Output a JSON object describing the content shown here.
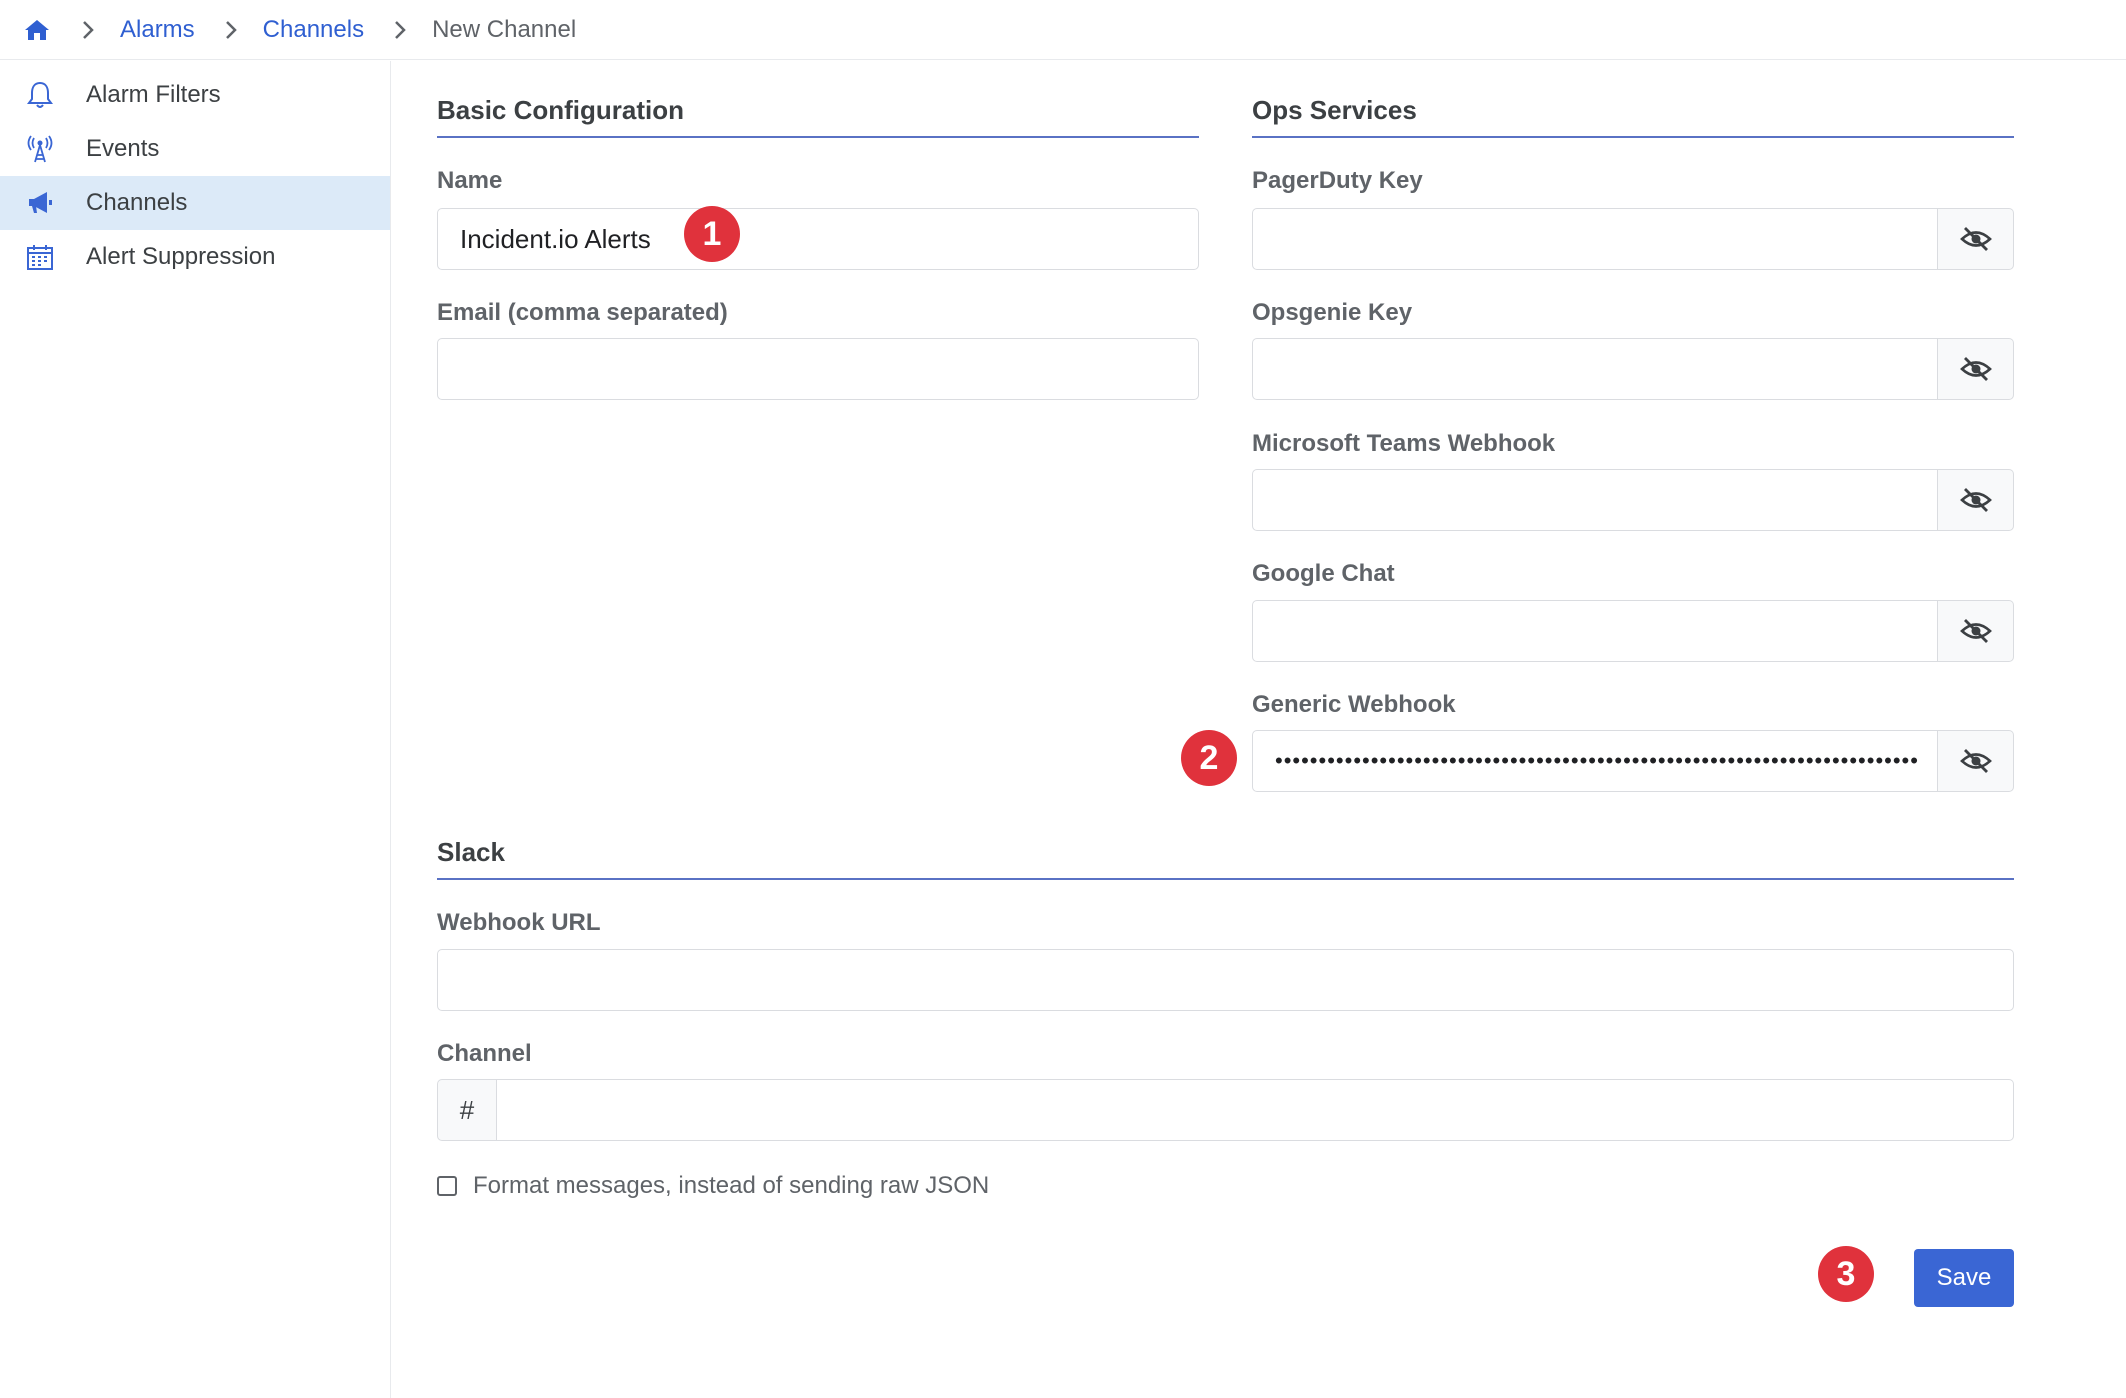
{
  "breadcrumb": {
    "home_icon": "home-icon",
    "items": [
      "Alarms",
      "Channels",
      "New Channel"
    ]
  },
  "sidebar": {
    "items": [
      {
        "label": "Alarm Filters",
        "icon": "bell-icon"
      },
      {
        "label": "Events",
        "icon": "antenna-icon"
      },
      {
        "label": "Channels",
        "icon": "megaphone-icon",
        "active": true
      },
      {
        "label": "Alert Suppression",
        "icon": "calendar-icon"
      }
    ]
  },
  "basic": {
    "title": "Basic Configuration",
    "name_label": "Name",
    "name_value": "Incident.io Alerts",
    "email_label": "Email (comma separated)",
    "email_value": ""
  },
  "ops": {
    "title": "Ops Services",
    "pagerduty_label": "PagerDuty Key",
    "opsgenie_label": "Opsgenie Key",
    "teams_label": "Microsoft Teams Webhook",
    "gchat_label": "Google Chat",
    "generic_label": "Generic Webhook",
    "generic_value": "••••••••••••••••••••••••••••••••••••••••••••••••••••••••••••••••••••••••••"
  },
  "slack": {
    "title": "Slack",
    "webhook_label": "Webhook URL",
    "channel_label": "Channel",
    "channel_prefix": "#",
    "format_label": "Format messages, instead of sending raw JSON",
    "format_checked": false
  },
  "actions": {
    "save_label": "Save"
  },
  "markers": [
    "1",
    "2",
    "3"
  ],
  "colors": {
    "link": "#2f5fd1",
    "active_bg": "#dceaf8",
    "rule": "#5a72c4",
    "primary_button": "#3a66d4",
    "marker": "#e0323c"
  }
}
